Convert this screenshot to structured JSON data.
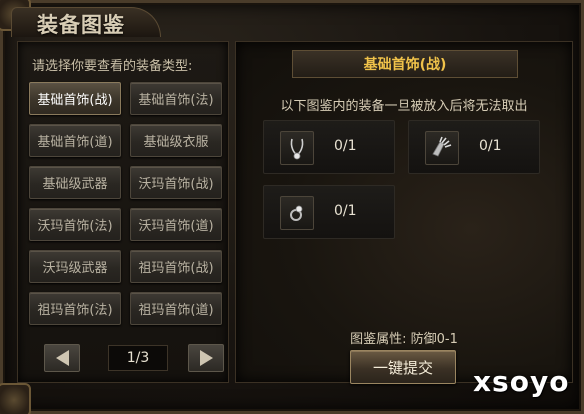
{
  "window": {
    "title": "装备图鉴"
  },
  "left_panel": {
    "prompt": "请选择你要查看的装备类型:",
    "types": [
      {
        "label": "基础首饰(战)",
        "active": true
      },
      {
        "label": "基础首饰(法)",
        "active": false
      },
      {
        "label": "基础首饰(道)",
        "active": false
      },
      {
        "label": "基础级衣服",
        "active": false
      },
      {
        "label": "基础级武器",
        "active": false
      },
      {
        "label": "沃玛首饰(战)",
        "active": false
      },
      {
        "label": "沃玛首饰(法)",
        "active": false
      },
      {
        "label": "沃玛首饰(道)",
        "active": false
      },
      {
        "label": "沃玛级武器",
        "active": false
      },
      {
        "label": "祖玛首饰(战)",
        "active": false
      },
      {
        "label": "祖玛首饰(法)",
        "active": false
      },
      {
        "label": "祖玛首饰(道)",
        "active": false
      }
    ],
    "pager": {
      "current": "1/3",
      "prev_icon": "left-arrow-icon",
      "next_icon": "right-arrow-icon"
    }
  },
  "right_panel": {
    "category_title": "基础首饰(战)",
    "notice": "以下图鉴内的装备一旦被放入后将无法取出",
    "slots": [
      {
        "icon": "necklace-icon",
        "count": "0/1"
      },
      {
        "icon": "bracelet-icon",
        "count": "0/1"
      },
      {
        "icon": "ring-icon",
        "count": "0/1"
      }
    ],
    "attribute": "图鉴属性: 防御0-1",
    "submit_label": "一键提交"
  },
  "watermark": "xsoyo",
  "colors": {
    "accent_title": "#f0c24a",
    "text": "#d6ccb5",
    "panel_border": "#3b3124"
  }
}
